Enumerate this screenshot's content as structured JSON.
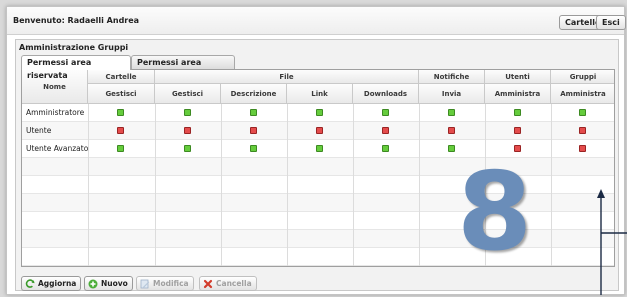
{
  "header": {
    "welcome": "Benvenuto: Radaelli Andrea",
    "cartelle_label": "Cartelle",
    "esci_label": "Esci"
  },
  "panel": {
    "title": "Amministrazione Gruppi",
    "tabs": [
      {
        "label": "Permessi area riservata",
        "active": true
      },
      {
        "label": "Permessi area pubblica",
        "active": false
      }
    ]
  },
  "grid": {
    "name_header": "Nome",
    "group_headers": [
      "Cartelle",
      "File",
      "Notifiche",
      "Utenti",
      "Gruppi"
    ],
    "sub_headers": [
      "Gestisci",
      "Gestisci",
      "Descrizione",
      "Link",
      "Downloads",
      "Invia",
      "Amministra",
      "Amministra"
    ],
    "rows": [
      {
        "name": "Amministratore",
        "perms": [
          true,
          true,
          true,
          true,
          true,
          true,
          true,
          true
        ]
      },
      {
        "name": "Utente",
        "perms": [
          false,
          false,
          false,
          false,
          false,
          false,
          false,
          false
        ]
      },
      {
        "name": "Utente Avanzato",
        "perms": [
          true,
          true,
          true,
          true,
          true,
          true,
          false,
          false
        ]
      }
    ],
    "empty_rows": 6
  },
  "footer": {
    "aggiorna_label": "Aggiorna",
    "nuovo_label": "Nuovo",
    "modifica_label": "Modifica",
    "cancella_label": "Cancella"
  },
  "annotation": {
    "number": "8"
  },
  "colors": {
    "allowed": "#65cc3c",
    "denied": "#e44c4c",
    "annotation": "#6a8db9"
  },
  "icons": {
    "aggiorna": "refresh-icon",
    "nuovo": "add-icon",
    "modifica": "edit-icon",
    "cancella": "delete-icon"
  }
}
